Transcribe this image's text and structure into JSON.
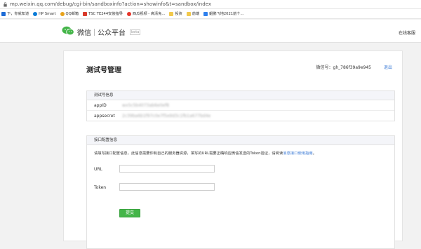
{
  "browser": {
    "url": "mp.weixin.qq.com/debug/cgi-bin/sandboxinfo?action=showinfo&t=sandbox/index",
    "bookmarks": [
      {
        "label": "下，你就知道",
        "color": "#1e6cd6"
      },
      {
        "label": "HP Smart",
        "color": "#0a7bd6"
      },
      {
        "label": "QQ邮箱",
        "color": "#e8a21a"
      },
      {
        "label": "TSC TE244安装指导",
        "color": "#d93a2b"
      },
      {
        "label": "西瓜视频 - 高清免...",
        "color": "#e6352a"
      },
      {
        "label": "投资",
        "color": "#f2c94c"
      },
      {
        "label": "前端",
        "color": "#f2c94c"
      },
      {
        "label": "鲲鹏飞地2021前个...",
        "color": "#2f80ed"
      }
    ]
  },
  "header": {
    "logo_text": "微信",
    "logo_subtitle": "公众平台",
    "logo_tag": "beta",
    "account_link": "在线客服"
  },
  "page": {
    "title": "测试号管理",
    "wechat_id_label": "微信号：",
    "wechat_id": "gh_786f39a9e945",
    "logout": "退出"
  },
  "test_info": {
    "header": "测试号信息",
    "rows": [
      {
        "key": "appID",
        "value": "wx5c5b4073ab6e0ef8"
      },
      {
        "key": "appsecret",
        "value": "2c39ba6b1f97c0e7f5e9d3c1fb1a677bd4e"
      }
    ]
  },
  "interface_config": {
    "header": "接口配置信息",
    "description": "请填写接口配置信息，此信息需要你有自己的服务器资源，填写的URL需要正确响应微信发送的Token验证，请阅读",
    "doc_link": "消息接口使用指南",
    "description_end": "。",
    "url_label": "URL",
    "url_value": "",
    "token_label": "Token",
    "token_value": "",
    "submit_label": "提交"
  },
  "colors": {
    "accent_green": "#44b549",
    "link_blue": "#3c7bd6"
  }
}
